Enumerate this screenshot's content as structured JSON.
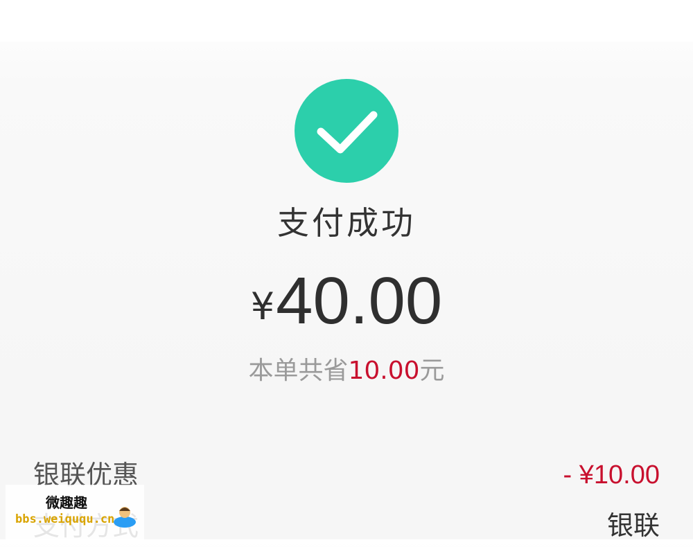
{
  "status": {
    "title": "支付成功",
    "icon": "check-circle-icon",
    "icon_color": "#2ccfab"
  },
  "payment": {
    "currency_symbol": "¥",
    "amount": "40.00"
  },
  "savings": {
    "prefix": "本单共省",
    "amount": "10.00",
    "suffix": "元",
    "highlight_color": "#c8102e"
  },
  "details": [
    {
      "label": "银联优惠",
      "value": "- ¥10.00"
    },
    {
      "label": "支付方式",
      "value": "银联"
    }
  ],
  "watermark": {
    "title": "微趣趣",
    "site": "bbs.weiququ.cn"
  }
}
